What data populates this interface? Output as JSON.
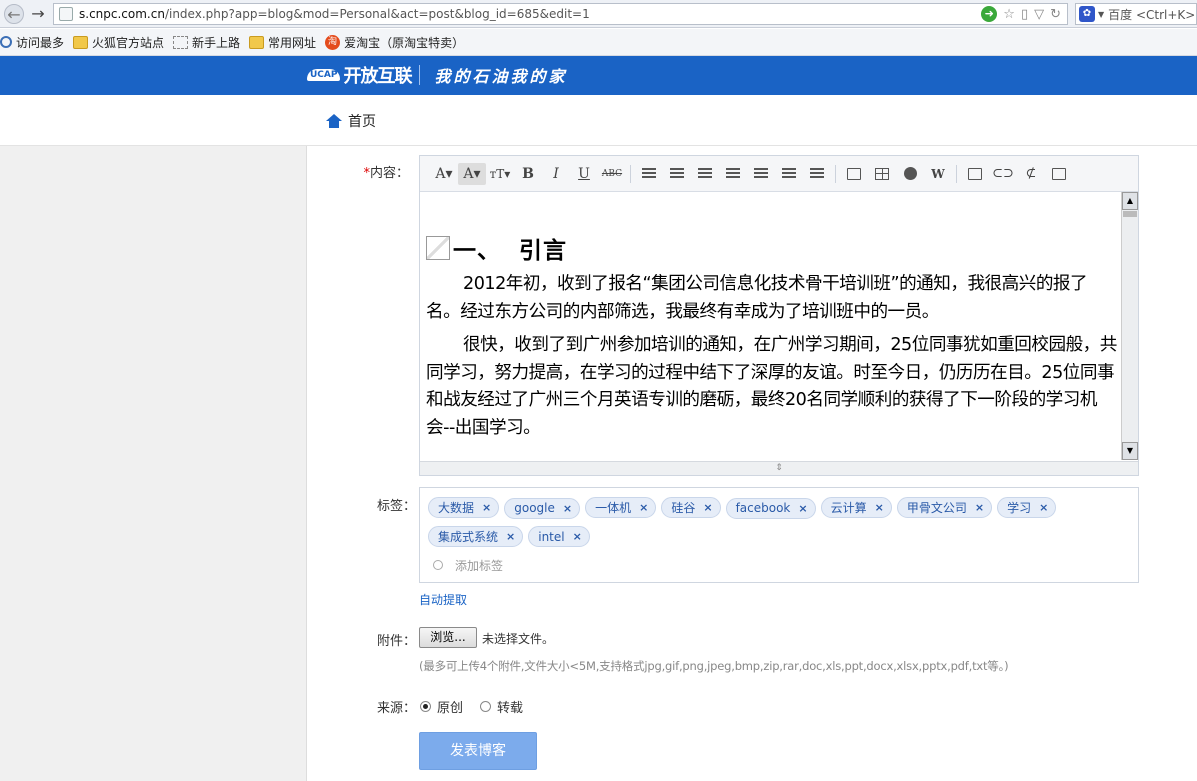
{
  "browser": {
    "url_host": "s.cnpc.com.cn",
    "url_path": "/index.php?app=blog&mod=Personal&act=post&blog_id=685&edit=1",
    "search_placeholder": "百度 <Ctrl+K>"
  },
  "bookmarks": [
    {
      "label": "访问最多",
      "icon": "search-icon"
    },
    {
      "label": "火狐官方站点",
      "icon": "folder-icon"
    },
    {
      "label": "新手上路",
      "icon": "page-icon"
    },
    {
      "label": "常用网址",
      "icon": "folder-icon"
    },
    {
      "label": "爱淘宝（原淘宝特卖）",
      "icon": "taobao-icon"
    }
  ],
  "site": {
    "logo_mark": "UCAP",
    "logo_text": "开放互联",
    "slogan": "我的石油我的家",
    "brand_color": "#1a63c5"
  },
  "nav": {
    "home": "首页"
  },
  "form": {
    "content_label": "内容：",
    "required_mark": "*",
    "tags_label": "标签：",
    "attach_label": "附件：",
    "source_label": "来源："
  },
  "editor": {
    "heading": "一、  引言",
    "paragraphs": [
      "2012年初，收到了报名“集团公司信息化技术骨干培训班”的通知，我很高兴的报了名。经过东方公司的内部筛选，我最终有幸成为了培训班中的一员。",
      "很快，收到了到广州参加培训的通知，在广州学习期间，25位同事犹如重回校园般，共同学习，努力提高，在学习的过程中结下了深厚的友谊。时至今日，仍历历在目。25位同事和战友经过了广州三个月英语专训的磨砺，最终20名同学顺利的获得了下一阶段的学习机会--出国学习。"
    ]
  },
  "tags": {
    "items": [
      "大数据",
      "google",
      "一体机",
      "硅谷",
      "facebook",
      "云计算",
      "甲骨文公司",
      "学习",
      "集成式系统",
      "intel"
    ],
    "remove_symbol": "×",
    "add_placeholder": "添加标签"
  },
  "auto_extract": "自动提取",
  "attachment": {
    "browse": "浏览...",
    "no_file": "未选择文件。",
    "hint": "(最多可上传4个附件,文件大小<5M,支持格式jpg,gif,png,jpeg,bmp,zip,rar,doc,xls,ppt,docx,xlsx,pptx,pdf,txt等。)"
  },
  "source": {
    "options": [
      {
        "label": "原创",
        "selected": true
      },
      {
        "label": "转载",
        "selected": false
      }
    ]
  },
  "submit": "发表博客"
}
